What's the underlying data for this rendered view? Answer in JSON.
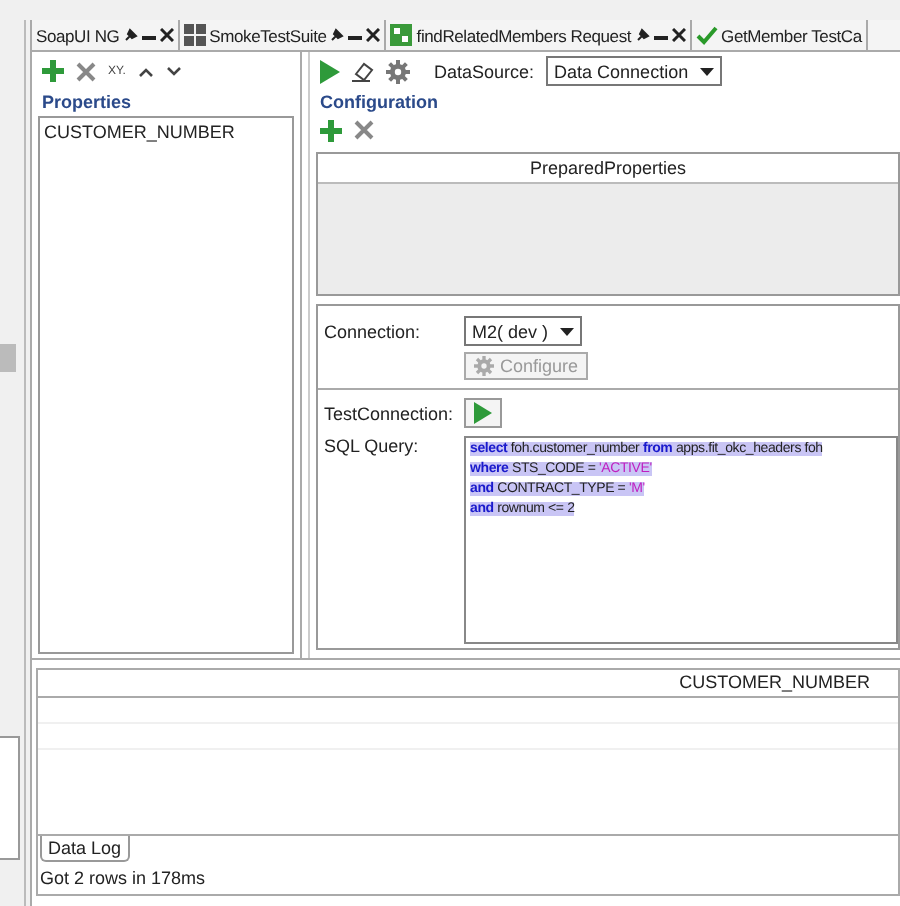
{
  "tabs": [
    {
      "label": "SoapUI NG",
      "kind": "project",
      "has_controls": true
    },
    {
      "label": "SmokeTestSuite",
      "kind": "suite",
      "has_controls": true
    },
    {
      "label": "findRelatedMembers Request",
      "kind": "request",
      "has_controls": true
    },
    {
      "label": "GetMember TestCa",
      "kind": "testcase",
      "has_controls": false
    }
  ],
  "properties": {
    "toolbar_label": "XY.",
    "heading": "Properties",
    "items": [
      "CUSTOMER_NUMBER"
    ]
  },
  "datasource": {
    "label": "DataSource:",
    "value": "Data Connection"
  },
  "configuration": {
    "heading": "Configuration",
    "table_header": "PreparedProperties",
    "connection_label": "Connection:",
    "connection_value": "M2( dev )",
    "configure_button": "Configure",
    "configure_disabled": true,
    "test_label": "TestConnection:",
    "sql_label": "SQL Query:",
    "sql_lines": [
      [
        {
          "kind": "keyword",
          "text": "select"
        },
        {
          "kind": "text",
          "text": " foh.customer_number "
        },
        {
          "kind": "keyword",
          "text": "from"
        },
        {
          "kind": "text",
          "text": " apps.fit_okc_headers foh"
        }
      ],
      [
        {
          "kind": "keyword",
          "text": "where"
        },
        {
          "kind": "text",
          "text": " STS_CODE = "
        },
        {
          "kind": "string",
          "text": "'ACTIVE'"
        }
      ],
      [
        {
          "kind": "keyword",
          "text": "and"
        },
        {
          "kind": "text",
          "text": " CONTRACT_TYPE = "
        },
        {
          "kind": "string",
          "text": "'M'"
        }
      ],
      [
        {
          "kind": "keyword",
          "text": "and"
        },
        {
          "kind": "text",
          "text": " rownum <= 2"
        }
      ]
    ]
  },
  "results": {
    "columns": [
      "CUSTOMER_NUMBER"
    ],
    "log_tab": "Data Log",
    "status": "Got 2 rows in 178ms"
  }
}
